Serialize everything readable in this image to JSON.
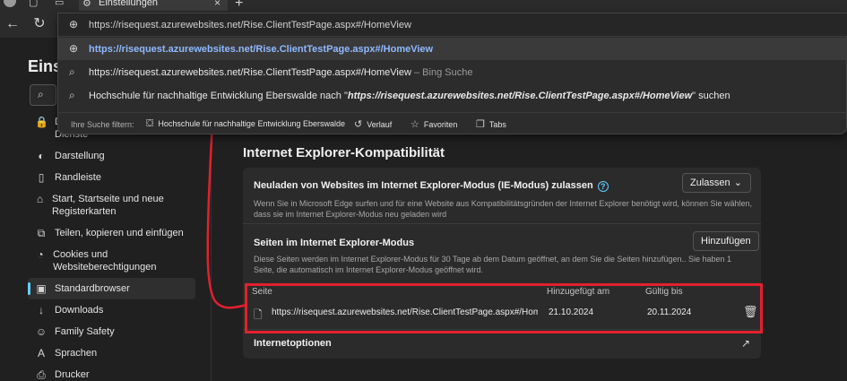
{
  "colors": {
    "accent": "#60cdff",
    "annotation": "#e4202e",
    "link_highlight": "#8fb9ff"
  },
  "tab": {
    "label": "Einstellungen",
    "close": "×",
    "new_tab": "+"
  },
  "address_bar": {
    "typed_url": "https://risequest.azurewebsites.net/Rise.ClientTestPage.aspx#/HomeView",
    "suggestions": [
      {
        "icon": "globe-icon",
        "text": "https://risequest.azurewebsites.net/Rise.ClientTestPage.aspx#/HomeView",
        "suffix": ""
      },
      {
        "icon": "search-icon",
        "text": "https://risequest.azurewebsites.net/Rise.ClientTestPage.aspx#/HomeView",
        "suffix": "– Bing Suche"
      },
      {
        "icon": "search-icon",
        "prefix": "Hochschule für nachhaltige Entwicklung Eberswalde nach \"",
        "bold": "https://risequest.azurewebsites.net/Rise.ClientTestPage.aspx#/HomeView",
        "suffix": "\" suchen"
      }
    ],
    "filter_label": "Ihre Suche filtern:",
    "filters": [
      "Hochschule für nachhaltige Entwicklung Eberswalde",
      "Verlauf",
      "Favoriten",
      "Tabs"
    ]
  },
  "settings": {
    "title": "Einst",
    "nav": [
      {
        "icon": "privacy-icon",
        "label": "Datenschutz, Suche und Dienste"
      },
      {
        "icon": "appearance-icon",
        "label": "Darstellung"
      },
      {
        "icon": "sidebar-icon",
        "label": "Randleiste"
      },
      {
        "icon": "home-icon",
        "label": "Start, Startseite und neue Registerkarten"
      },
      {
        "icon": "share-icon",
        "label": "Teilen, kopieren und einfügen"
      },
      {
        "icon": "cookie-icon",
        "label": "Cookies und Websiteberechtigungen"
      },
      {
        "icon": "default-browser-icon",
        "label": "Standardbrowser",
        "active": true
      },
      {
        "icon": "download-icon",
        "label": "Downloads"
      },
      {
        "icon": "family-icon",
        "label": "Family Safety"
      },
      {
        "icon": "language-icon",
        "label": "Sprachen"
      },
      {
        "icon": "printer-icon",
        "label": "Drucker"
      }
    ]
  },
  "ie_compat": {
    "section_title": "Internet Explorer-Kompatibilität",
    "reload_title": "Neuladen von Websites im Internet Explorer-Modus (IE-Modus) zulassen",
    "reload_desc": "Wenn Sie in Microsoft Edge surfen und für eine Website aus Kompatibilitätsgründen der Internet Explorer benötigt wird, können Sie wählen, dass sie im Internet Explorer-Modus neu geladen wird",
    "reload_select": "Zulassen",
    "pages_title": "Seiten im Internet Explorer-Modus",
    "pages_desc": "Diese Seiten werden im Internet Explorer-Modus für 30 Tage ab dem Datum geöffnet, an dem Sie die Seiten hinzufügen.. Sie haben 1 Seite, die automatisch im Internet Explorer-Modus geöffnet wird.",
    "add_button": "Hinzufügen",
    "columns": [
      "Seite",
      "Hinzugefügt am",
      "Gültig bis"
    ],
    "row": {
      "page": "https://risequest.azurewebsites.net/Rise.ClientTestPage.aspx#/HomeView",
      "added": "21.10.2024",
      "valid": "20.11.2024"
    },
    "internet_options": "Internetoptionen"
  }
}
